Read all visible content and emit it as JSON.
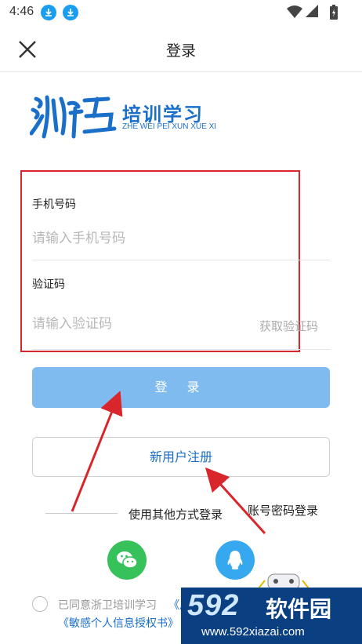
{
  "status_bar": {
    "time": "4:46",
    "icons": [
      "download-icon",
      "download-icon",
      "wifi-icon",
      "signal-icon",
      "battery-icon"
    ]
  },
  "header": {
    "title": "登录",
    "close_icon": "close-icon"
  },
  "logo": {
    "title": "培训学习",
    "subtitle": "ZHE WEI PEI XUN XUE XI",
    "brand_color": "#1a6fc9"
  },
  "form": {
    "phone": {
      "label": "手机号码",
      "placeholder": "请输入手机号码",
      "value": ""
    },
    "code": {
      "label": "验证码",
      "placeholder": "请输入验证码",
      "value": "",
      "get_code": "获取验证码"
    },
    "highlight_color": "#d9262c"
  },
  "buttons": {
    "login": "登 录",
    "register": "新用户注册",
    "login_color": "#7fbbef"
  },
  "other_login": {
    "label": "使用其他方式登录",
    "annotation": "账号密码登录",
    "wechat_icon": "wechat-icon",
    "qq_icon": "qq-icon"
  },
  "agreement": {
    "prefix": "已同意浙卫培训学习",
    "link1": "《用户协议》",
    "link2": "《敏感个人信息授权书》"
  },
  "watermark": {
    "number": "592",
    "name": "软件园",
    "url": "www.592xiazai.com"
  }
}
